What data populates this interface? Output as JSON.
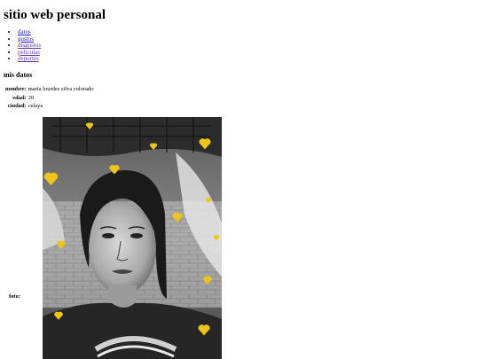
{
  "page": {
    "title": "sitio web personal",
    "nav_links": [
      "datos",
      "gustos",
      "disgustos",
      "peliculas",
      "deportes"
    ],
    "section_title": "mis datos",
    "fields": [
      {
        "label": "nombre:",
        "value": "maria lourdes silva colorado"
      },
      {
        "label": "edad:",
        "value": "20"
      },
      {
        "label": "ciudad:",
        "value": "celaya"
      }
    ],
    "photo_label": "foto:"
  },
  "colors": {
    "link": "#2222cc",
    "link_visited": "#6633aa",
    "heart": "#f0c419"
  },
  "photo": {
    "description_icon": "portrait-photo",
    "decoration_icon": "heart-icon"
  }
}
